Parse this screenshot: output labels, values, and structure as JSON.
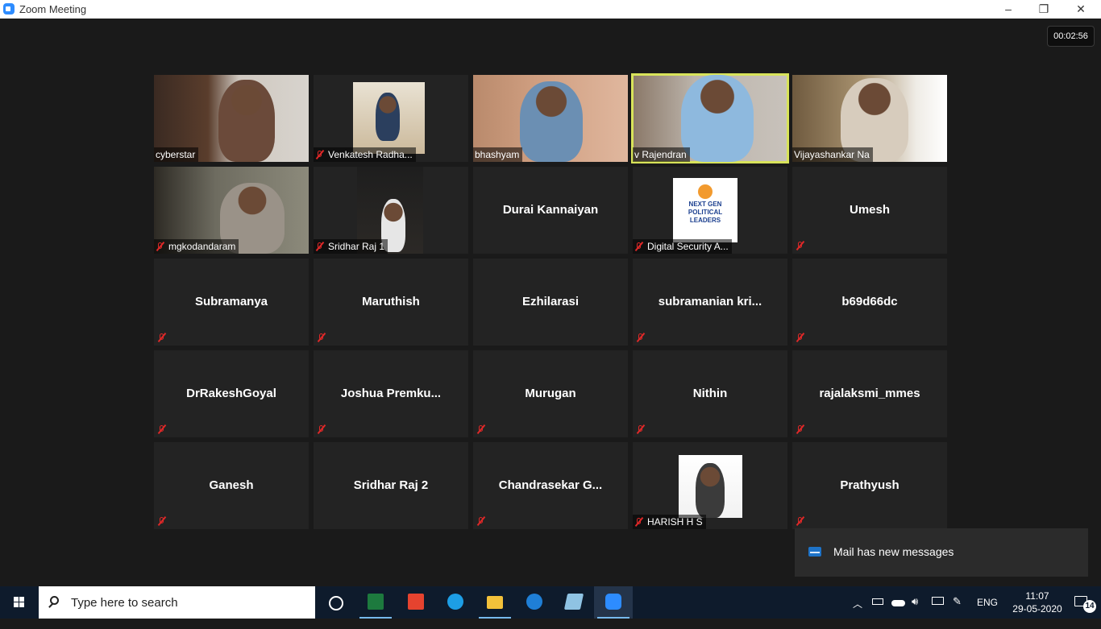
{
  "window": {
    "title": "Zoom Meeting",
    "minimize_label": "–",
    "restore_label": "❐",
    "close_label": "✕"
  },
  "meeting": {
    "timer": "00:02:56"
  },
  "participants": [
    {
      "name": "cyberstar",
      "video": true,
      "muted": false
    },
    {
      "name": "Venkatesh Radha...",
      "video": true,
      "muted": true
    },
    {
      "name": "bhashyam",
      "video": true,
      "muted": false
    },
    {
      "name": "v Rajendran",
      "video": true,
      "muted": false,
      "active_speaker": true
    },
    {
      "name": "Vijayashankar Na",
      "video": true,
      "muted": false
    },
    {
      "name": "mgkodandaram",
      "video": true,
      "muted": true
    },
    {
      "name": "Sridhar Raj 1",
      "video": true,
      "muted": true
    },
    {
      "name": "Durai Kannaiyan",
      "video": false,
      "muted": false
    },
    {
      "name": "Digital Security A...",
      "video": true,
      "muted": true,
      "avatar_text": [
        "NEXT GEN",
        "POLITICAL LEADERS"
      ]
    },
    {
      "name": "Umesh",
      "video": false,
      "muted": true
    },
    {
      "name": "Subramanya",
      "video": false,
      "muted": true
    },
    {
      "name": "Maruthish",
      "video": false,
      "muted": true
    },
    {
      "name": "Ezhilarasi",
      "video": false,
      "muted": false
    },
    {
      "name": "subramanian  kri...",
      "video": false,
      "muted": true
    },
    {
      "name": "b69d66dc",
      "video": false,
      "muted": true
    },
    {
      "name": "DrRakeshGoyal",
      "video": false,
      "muted": true
    },
    {
      "name": "Joshua  Premku...",
      "video": false,
      "muted": true
    },
    {
      "name": "Murugan",
      "video": false,
      "muted": true
    },
    {
      "name": "Nithin",
      "video": false,
      "muted": true
    },
    {
      "name": "rajalaksmi_mmes",
      "video": false,
      "muted": true
    },
    {
      "name": "Ganesh",
      "video": false,
      "muted": true
    },
    {
      "name": "Sridhar Raj 2",
      "video": false,
      "muted": false
    },
    {
      "name": "Chandrasekar  G...",
      "video": false,
      "muted": true
    },
    {
      "name": "HARISH H S",
      "video": true,
      "muted": true
    },
    {
      "name": "Prathyush",
      "video": false,
      "muted": true
    }
  ],
  "toast": {
    "message": "Mail has new messages"
  },
  "taskbar": {
    "search_placeholder": "Type here to search",
    "apps": [
      "task-view-icon",
      "excel-icon",
      "wps-icon",
      "skype-icon",
      "file-explorer-icon",
      "edge-icon",
      "notepad-icon",
      "zoom-icon"
    ],
    "language": "ENG",
    "time": "11:07",
    "date": "29-05-2020",
    "notification_count": "14"
  },
  "colors": {
    "active_speaker_border": "#d8e35a",
    "tile_bg": "#232323",
    "background": "#1a1a1a",
    "taskbar": "#0e1b2c",
    "mute_red": "#e02828"
  }
}
